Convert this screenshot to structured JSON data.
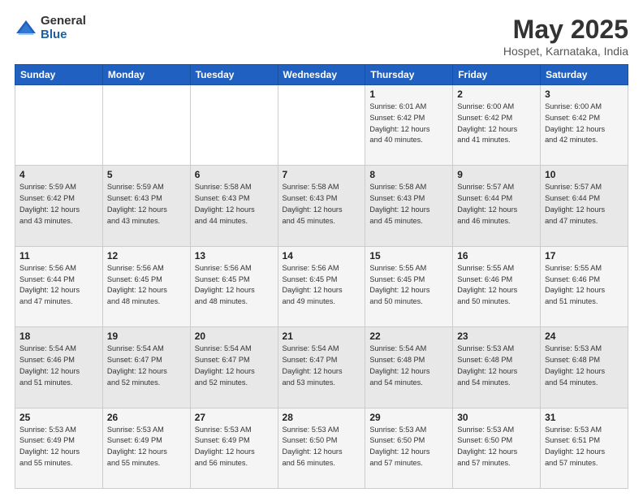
{
  "logo": {
    "general": "General",
    "blue": "Blue"
  },
  "title": "May 2025",
  "subtitle": "Hospet, Karnataka, India",
  "days_header": [
    "Sunday",
    "Monday",
    "Tuesday",
    "Wednesday",
    "Thursday",
    "Friday",
    "Saturday"
  ],
  "weeks": [
    [
      {
        "day": "",
        "info": ""
      },
      {
        "day": "",
        "info": ""
      },
      {
        "day": "",
        "info": ""
      },
      {
        "day": "",
        "info": ""
      },
      {
        "day": "1",
        "info": "Sunrise: 6:01 AM\nSunset: 6:42 PM\nDaylight: 12 hours\nand 40 minutes."
      },
      {
        "day": "2",
        "info": "Sunrise: 6:00 AM\nSunset: 6:42 PM\nDaylight: 12 hours\nand 41 minutes."
      },
      {
        "day": "3",
        "info": "Sunrise: 6:00 AM\nSunset: 6:42 PM\nDaylight: 12 hours\nand 42 minutes."
      }
    ],
    [
      {
        "day": "4",
        "info": "Sunrise: 5:59 AM\nSunset: 6:42 PM\nDaylight: 12 hours\nand 43 minutes."
      },
      {
        "day": "5",
        "info": "Sunrise: 5:59 AM\nSunset: 6:43 PM\nDaylight: 12 hours\nand 43 minutes."
      },
      {
        "day": "6",
        "info": "Sunrise: 5:58 AM\nSunset: 6:43 PM\nDaylight: 12 hours\nand 44 minutes."
      },
      {
        "day": "7",
        "info": "Sunrise: 5:58 AM\nSunset: 6:43 PM\nDaylight: 12 hours\nand 45 minutes."
      },
      {
        "day": "8",
        "info": "Sunrise: 5:58 AM\nSunset: 6:43 PM\nDaylight: 12 hours\nand 45 minutes."
      },
      {
        "day": "9",
        "info": "Sunrise: 5:57 AM\nSunset: 6:44 PM\nDaylight: 12 hours\nand 46 minutes."
      },
      {
        "day": "10",
        "info": "Sunrise: 5:57 AM\nSunset: 6:44 PM\nDaylight: 12 hours\nand 47 minutes."
      }
    ],
    [
      {
        "day": "11",
        "info": "Sunrise: 5:56 AM\nSunset: 6:44 PM\nDaylight: 12 hours\nand 47 minutes."
      },
      {
        "day": "12",
        "info": "Sunrise: 5:56 AM\nSunset: 6:45 PM\nDaylight: 12 hours\nand 48 minutes."
      },
      {
        "day": "13",
        "info": "Sunrise: 5:56 AM\nSunset: 6:45 PM\nDaylight: 12 hours\nand 48 minutes."
      },
      {
        "day": "14",
        "info": "Sunrise: 5:56 AM\nSunset: 6:45 PM\nDaylight: 12 hours\nand 49 minutes."
      },
      {
        "day": "15",
        "info": "Sunrise: 5:55 AM\nSunset: 6:45 PM\nDaylight: 12 hours\nand 50 minutes."
      },
      {
        "day": "16",
        "info": "Sunrise: 5:55 AM\nSunset: 6:46 PM\nDaylight: 12 hours\nand 50 minutes."
      },
      {
        "day": "17",
        "info": "Sunrise: 5:55 AM\nSunset: 6:46 PM\nDaylight: 12 hours\nand 51 minutes."
      }
    ],
    [
      {
        "day": "18",
        "info": "Sunrise: 5:54 AM\nSunset: 6:46 PM\nDaylight: 12 hours\nand 51 minutes."
      },
      {
        "day": "19",
        "info": "Sunrise: 5:54 AM\nSunset: 6:47 PM\nDaylight: 12 hours\nand 52 minutes."
      },
      {
        "day": "20",
        "info": "Sunrise: 5:54 AM\nSunset: 6:47 PM\nDaylight: 12 hours\nand 52 minutes."
      },
      {
        "day": "21",
        "info": "Sunrise: 5:54 AM\nSunset: 6:47 PM\nDaylight: 12 hours\nand 53 minutes."
      },
      {
        "day": "22",
        "info": "Sunrise: 5:54 AM\nSunset: 6:48 PM\nDaylight: 12 hours\nand 54 minutes."
      },
      {
        "day": "23",
        "info": "Sunrise: 5:53 AM\nSunset: 6:48 PM\nDaylight: 12 hours\nand 54 minutes."
      },
      {
        "day": "24",
        "info": "Sunrise: 5:53 AM\nSunset: 6:48 PM\nDaylight: 12 hours\nand 54 minutes."
      }
    ],
    [
      {
        "day": "25",
        "info": "Sunrise: 5:53 AM\nSunset: 6:49 PM\nDaylight: 12 hours\nand 55 minutes."
      },
      {
        "day": "26",
        "info": "Sunrise: 5:53 AM\nSunset: 6:49 PM\nDaylight: 12 hours\nand 55 minutes."
      },
      {
        "day": "27",
        "info": "Sunrise: 5:53 AM\nSunset: 6:49 PM\nDaylight: 12 hours\nand 56 minutes."
      },
      {
        "day": "28",
        "info": "Sunrise: 5:53 AM\nSunset: 6:50 PM\nDaylight: 12 hours\nand 56 minutes."
      },
      {
        "day": "29",
        "info": "Sunrise: 5:53 AM\nSunset: 6:50 PM\nDaylight: 12 hours\nand 57 minutes."
      },
      {
        "day": "30",
        "info": "Sunrise: 5:53 AM\nSunset: 6:50 PM\nDaylight: 12 hours\nand 57 minutes."
      },
      {
        "day": "31",
        "info": "Sunrise: 5:53 AM\nSunset: 6:51 PM\nDaylight: 12 hours\nand 57 minutes."
      }
    ]
  ]
}
